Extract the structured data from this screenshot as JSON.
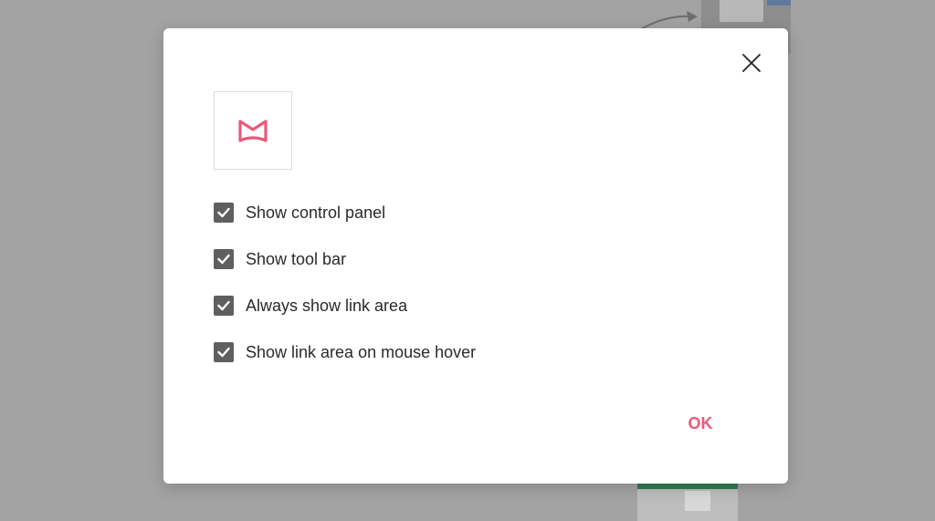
{
  "dialog": {
    "close_icon": "close-icon",
    "logo_icon": "app-logo-m-icon",
    "accent_color": "#ea5a7a",
    "options": [
      {
        "label": "Show control panel",
        "checked": true
      },
      {
        "label": "Show tool bar",
        "checked": true
      },
      {
        "label": "Always show link area",
        "checked": true
      },
      {
        "label": "Show link area on mouse hover",
        "checked": true
      }
    ],
    "ok_label": "OK"
  }
}
